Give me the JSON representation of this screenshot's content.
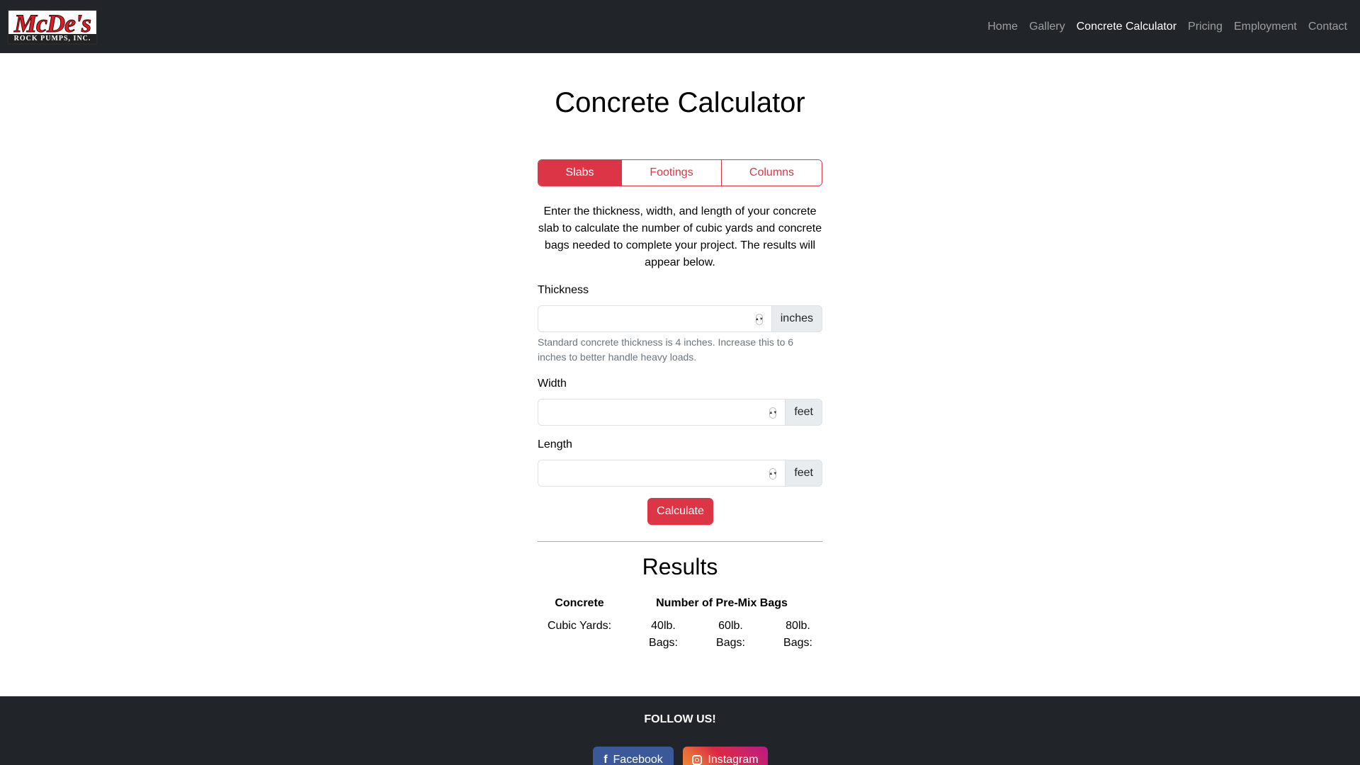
{
  "header": {
    "logo": {
      "main": "McDe's",
      "sub": "ROCK PUMPS, INC."
    },
    "nav": [
      {
        "label": "Home",
        "active": false
      },
      {
        "label": "Gallery",
        "active": false
      },
      {
        "label": "Concrete Calculator",
        "active": true
      },
      {
        "label": "Pricing",
        "active": false
      },
      {
        "label": "Employment",
        "active": false
      },
      {
        "label": "Contact",
        "active": false
      }
    ]
  },
  "main": {
    "title": "Concrete Calculator",
    "tabs": [
      {
        "label": "Slabs",
        "active": true
      },
      {
        "label": "Footings",
        "active": false
      },
      {
        "label": "Columns",
        "active": false
      }
    ],
    "intro": "Enter the thickness, width, and length of your concrete slab to calculate the number of cubic yards and concrete bags needed to complete your project. The results will appear below.",
    "thickness": {
      "label": "Thickness",
      "value": "",
      "unit": "inches",
      "help": "Standard concrete thickness is 4 inches. Increase this to 6 inches to better handle heavy loads."
    },
    "width": {
      "label": "Width",
      "value": "",
      "unit": "feet"
    },
    "length": {
      "label": "Length",
      "value": "",
      "unit": "feet"
    },
    "calculate_label": "Calculate",
    "results": {
      "title": "Results",
      "concrete_header": "Concrete",
      "bags_header": "Number of Pre-Mix Bags",
      "cubic_yards_label": "Cubic Yards:",
      "bag_40_label": "40lb. Bags:",
      "bag_60_label": "60lb. Bags:",
      "bag_80_label": "80lb. Bags:"
    }
  },
  "footer": {
    "follow": "FOLLOW US!",
    "facebook": "Facebook",
    "instagram": "Instagram"
  },
  "colors": {
    "accent": "#dc3545",
    "navbar": "#212529",
    "facebook": "#3b5998"
  }
}
